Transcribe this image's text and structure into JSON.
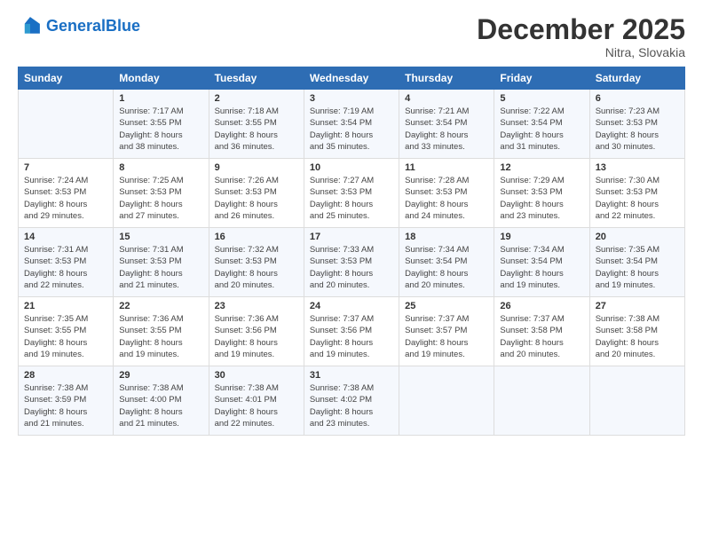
{
  "header": {
    "logo_general": "General",
    "logo_blue": "Blue",
    "month_title": "December 2025",
    "subtitle": "Nitra, Slovakia"
  },
  "days_of_week": [
    "Sunday",
    "Monday",
    "Tuesday",
    "Wednesday",
    "Thursday",
    "Friday",
    "Saturday"
  ],
  "weeks": [
    [
      {
        "day": "",
        "info": ""
      },
      {
        "day": "1",
        "info": "Sunrise: 7:17 AM\nSunset: 3:55 PM\nDaylight: 8 hours\nand 38 minutes."
      },
      {
        "day": "2",
        "info": "Sunrise: 7:18 AM\nSunset: 3:55 PM\nDaylight: 8 hours\nand 36 minutes."
      },
      {
        "day": "3",
        "info": "Sunrise: 7:19 AM\nSunset: 3:54 PM\nDaylight: 8 hours\nand 35 minutes."
      },
      {
        "day": "4",
        "info": "Sunrise: 7:21 AM\nSunset: 3:54 PM\nDaylight: 8 hours\nand 33 minutes."
      },
      {
        "day": "5",
        "info": "Sunrise: 7:22 AM\nSunset: 3:54 PM\nDaylight: 8 hours\nand 31 minutes."
      },
      {
        "day": "6",
        "info": "Sunrise: 7:23 AM\nSunset: 3:53 PM\nDaylight: 8 hours\nand 30 minutes."
      }
    ],
    [
      {
        "day": "7",
        "info": "Sunrise: 7:24 AM\nSunset: 3:53 PM\nDaylight: 8 hours\nand 29 minutes."
      },
      {
        "day": "8",
        "info": "Sunrise: 7:25 AM\nSunset: 3:53 PM\nDaylight: 8 hours\nand 27 minutes."
      },
      {
        "day": "9",
        "info": "Sunrise: 7:26 AM\nSunset: 3:53 PM\nDaylight: 8 hours\nand 26 minutes."
      },
      {
        "day": "10",
        "info": "Sunrise: 7:27 AM\nSunset: 3:53 PM\nDaylight: 8 hours\nand 25 minutes."
      },
      {
        "day": "11",
        "info": "Sunrise: 7:28 AM\nSunset: 3:53 PM\nDaylight: 8 hours\nand 24 minutes."
      },
      {
        "day": "12",
        "info": "Sunrise: 7:29 AM\nSunset: 3:53 PM\nDaylight: 8 hours\nand 23 minutes."
      },
      {
        "day": "13",
        "info": "Sunrise: 7:30 AM\nSunset: 3:53 PM\nDaylight: 8 hours\nand 22 minutes."
      }
    ],
    [
      {
        "day": "14",
        "info": "Sunrise: 7:31 AM\nSunset: 3:53 PM\nDaylight: 8 hours\nand 22 minutes."
      },
      {
        "day": "15",
        "info": "Sunrise: 7:31 AM\nSunset: 3:53 PM\nDaylight: 8 hours\nand 21 minutes."
      },
      {
        "day": "16",
        "info": "Sunrise: 7:32 AM\nSunset: 3:53 PM\nDaylight: 8 hours\nand 20 minutes."
      },
      {
        "day": "17",
        "info": "Sunrise: 7:33 AM\nSunset: 3:53 PM\nDaylight: 8 hours\nand 20 minutes."
      },
      {
        "day": "18",
        "info": "Sunrise: 7:34 AM\nSunset: 3:54 PM\nDaylight: 8 hours\nand 20 minutes."
      },
      {
        "day": "19",
        "info": "Sunrise: 7:34 AM\nSunset: 3:54 PM\nDaylight: 8 hours\nand 19 minutes."
      },
      {
        "day": "20",
        "info": "Sunrise: 7:35 AM\nSunset: 3:54 PM\nDaylight: 8 hours\nand 19 minutes."
      }
    ],
    [
      {
        "day": "21",
        "info": "Sunrise: 7:35 AM\nSunset: 3:55 PM\nDaylight: 8 hours\nand 19 minutes."
      },
      {
        "day": "22",
        "info": "Sunrise: 7:36 AM\nSunset: 3:55 PM\nDaylight: 8 hours\nand 19 minutes."
      },
      {
        "day": "23",
        "info": "Sunrise: 7:36 AM\nSunset: 3:56 PM\nDaylight: 8 hours\nand 19 minutes."
      },
      {
        "day": "24",
        "info": "Sunrise: 7:37 AM\nSunset: 3:56 PM\nDaylight: 8 hours\nand 19 minutes."
      },
      {
        "day": "25",
        "info": "Sunrise: 7:37 AM\nSunset: 3:57 PM\nDaylight: 8 hours\nand 19 minutes."
      },
      {
        "day": "26",
        "info": "Sunrise: 7:37 AM\nSunset: 3:58 PM\nDaylight: 8 hours\nand 20 minutes."
      },
      {
        "day": "27",
        "info": "Sunrise: 7:38 AM\nSunset: 3:58 PM\nDaylight: 8 hours\nand 20 minutes."
      }
    ],
    [
      {
        "day": "28",
        "info": "Sunrise: 7:38 AM\nSunset: 3:59 PM\nDaylight: 8 hours\nand 21 minutes."
      },
      {
        "day": "29",
        "info": "Sunrise: 7:38 AM\nSunset: 4:00 PM\nDaylight: 8 hours\nand 21 minutes."
      },
      {
        "day": "30",
        "info": "Sunrise: 7:38 AM\nSunset: 4:01 PM\nDaylight: 8 hours\nand 22 minutes."
      },
      {
        "day": "31",
        "info": "Sunrise: 7:38 AM\nSunset: 4:02 PM\nDaylight: 8 hours\nand 23 minutes."
      },
      {
        "day": "",
        "info": ""
      },
      {
        "day": "",
        "info": ""
      },
      {
        "day": "",
        "info": ""
      }
    ]
  ]
}
